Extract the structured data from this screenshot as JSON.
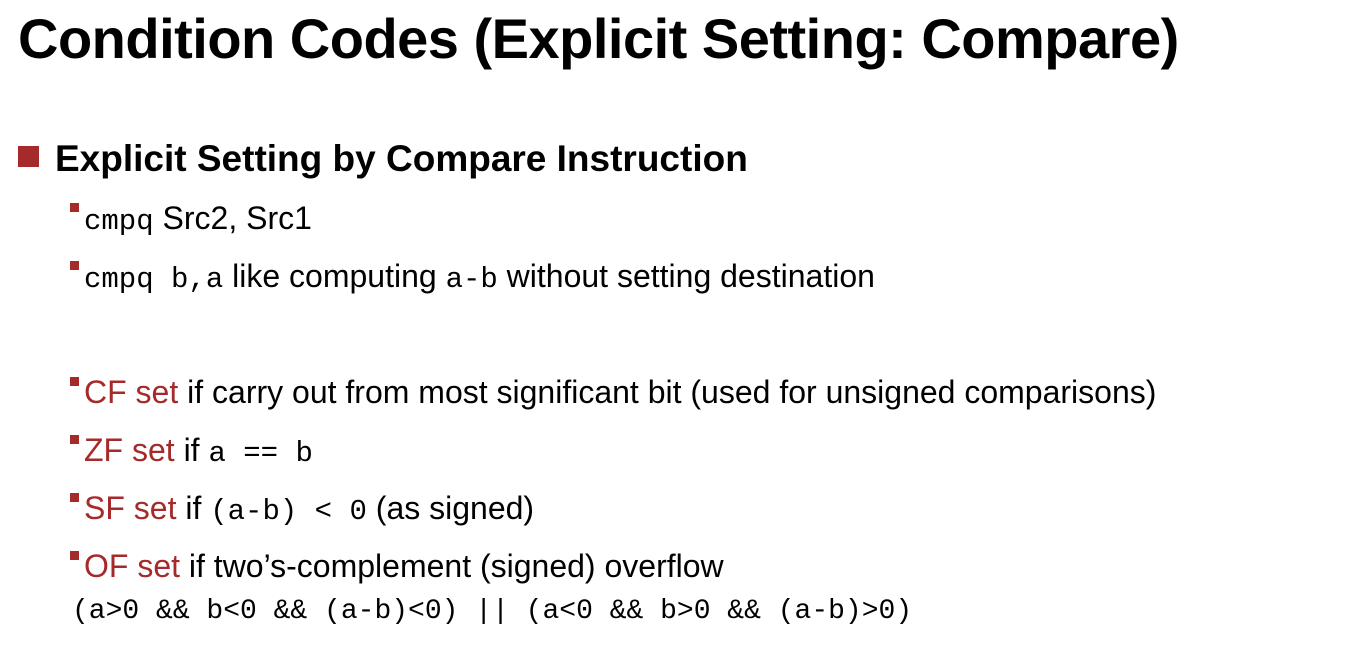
{
  "title": "Condition Codes (Explicit Setting: Compare)",
  "heading": "Explicit Setting by Compare Instruction",
  "item1": {
    "code": "cmpq",
    "text": " Src2, Src1"
  },
  "item2": {
    "code1": "cmpq b,a",
    "text1": " like computing ",
    "code2": "a-b",
    "text2": " without setting destination"
  },
  "flags": [
    {
      "flag": "CF set",
      "text": " if carry out from most significant bit (used for unsigned comparisons)"
    },
    {
      "flag": "ZF set",
      "text": " if ",
      "code": "a == b"
    },
    {
      "flag": "SF set",
      "text": " if ",
      "code": "(a-b) < 0",
      "suffix": " (as signed)"
    },
    {
      "flag": "OF set",
      "text": " if two’s-complement (signed) overflow"
    }
  ],
  "overflow_expr": "(a>0 && b<0 && (a-b)<0) || (a<0 && b>0 && (a-b)>0)",
  "colors": {
    "accent": "#a52a2a"
  }
}
